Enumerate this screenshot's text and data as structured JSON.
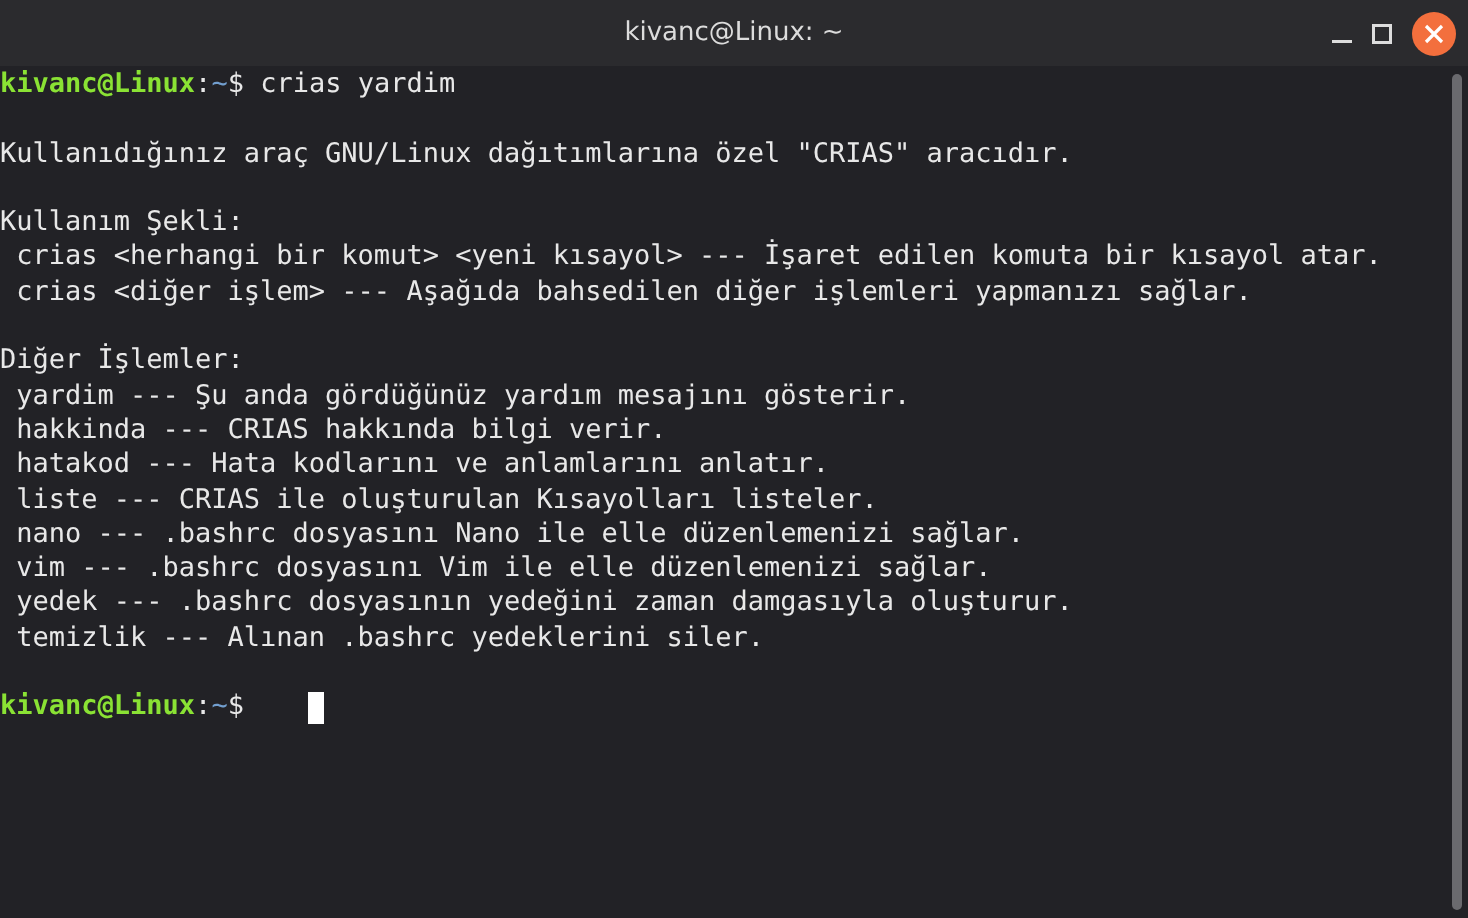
{
  "window": {
    "title": "kivanc@Linux: ~"
  },
  "lines": [
    {
      "kind": "prompt",
      "user": "kivanc@Linux",
      "sep": ":",
      "path": "~",
      "symbol": "$",
      "command": " crias yardim"
    },
    {
      "kind": "blank"
    },
    {
      "kind": "text",
      "text": "Kullanıdığınız araç GNU/Linux dağıtımlarına özel \"CRIAS\" aracıdır."
    },
    {
      "kind": "blank"
    },
    {
      "kind": "text",
      "text": "Kullanım Şekli:"
    },
    {
      "kind": "text",
      "text": " crias <herhangi bir komut> <yeni kısayol> --- İşaret edilen komuta bir kısayol atar."
    },
    {
      "kind": "text",
      "text": " crias <diğer işlem> --- Aşağıda bahsedilen diğer işlemleri yapmanızı sağlar."
    },
    {
      "kind": "blank"
    },
    {
      "kind": "text",
      "text": "Diğer İşlemler:"
    },
    {
      "kind": "text",
      "text": " yardim --- Şu anda gördüğünüz yardım mesajını gösterir."
    },
    {
      "kind": "text",
      "text": " hakkinda --- CRIAS hakkında bilgi verir."
    },
    {
      "kind": "text",
      "text": " hatakod --- Hata kodlarını ve anlamlarını anlatır."
    },
    {
      "kind": "text",
      "text": " liste --- CRIAS ile oluşturulan Kısayolları listeler."
    },
    {
      "kind": "text",
      "text": " nano --- .bashrc dosyasını Nano ile elle düzenlemenizi sağlar."
    },
    {
      "kind": "text",
      "text": " vim --- .bashrc dosyasını Vim ile elle düzenlemenizi sağlar."
    },
    {
      "kind": "text",
      "text": " yedek --- .bashrc dosyasının yedeğini zaman damgasıyla oluşturur."
    },
    {
      "kind": "text",
      "text": " temizlik --- Alınan .bashrc yedeklerini siler."
    },
    {
      "kind": "blank"
    },
    {
      "kind": "prompt",
      "user": "kivanc@Linux",
      "sep": ":",
      "path": "~",
      "symbol": "$",
      "cursor": true
    }
  ]
}
